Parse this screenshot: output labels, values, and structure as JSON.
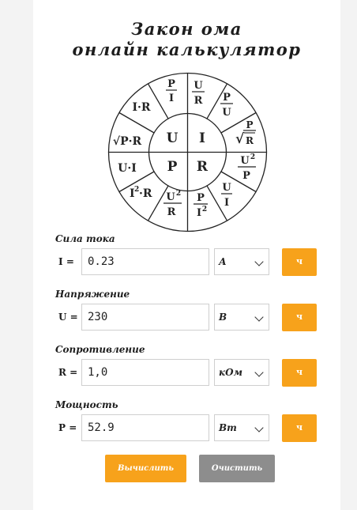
{
  "header": {
    "title_line1": "Закон ома",
    "title_line2": "онлайн калькулятор"
  },
  "wheel": {
    "center": [
      "U",
      "I",
      "P",
      "R"
    ],
    "outer": {
      "p_over_i": [
        "P",
        "I"
      ],
      "u_over_r": [
        "U",
        "R"
      ],
      "p_over_u": [
        "P",
        "U"
      ],
      "sqrt_p_over_r": [
        "√",
        "P",
        "R"
      ],
      "u2_over_p": [
        "U",
        "2",
        "P"
      ],
      "u_over_i": [
        "U",
        "I"
      ],
      "p_over_i2": [
        "P",
        "I",
        "2"
      ],
      "u2_over_r": [
        "U",
        "2",
        "R"
      ],
      "i2_r": [
        "I",
        "2",
        "·R"
      ],
      "u_i": "U·I",
      "sqrt_pr": "√P·R",
      "i_r": "I·R"
    }
  },
  "fields": [
    {
      "label": "Сила тока",
      "symbol": "I",
      "eq": "=",
      "value": "0.23",
      "unit": "А",
      "button": "ч"
    },
    {
      "label": "Напряжение",
      "symbol": "U",
      "eq": "=",
      "value": "230",
      "unit": "В",
      "button": "ч"
    },
    {
      "label": "Сопротивление",
      "symbol": "R",
      "eq": "=",
      "value": "1,0",
      "unit": "кОм",
      "button": "ч"
    },
    {
      "label": "Мощность",
      "symbol": "P",
      "eq": "=",
      "value": "52.9",
      "unit": "Вт",
      "button": "ч"
    }
  ],
  "actions": {
    "calculate_label": "Вычислить",
    "clear_label": "Очистить"
  },
  "colors": {
    "accent": "#f7a21b",
    "secondary": "#8d8d8d"
  }
}
